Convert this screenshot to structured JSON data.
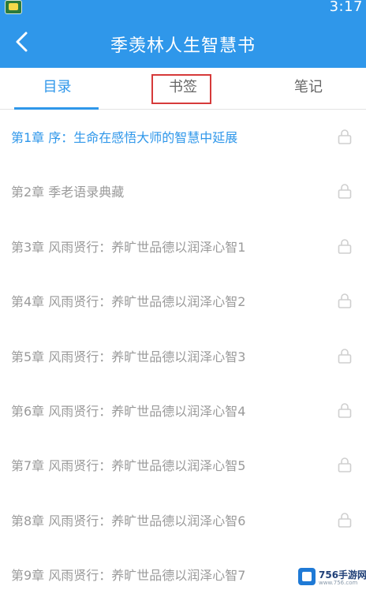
{
  "status_bar": {
    "time": "3:17",
    "app_icon": "app-icon"
  },
  "header": {
    "title": "季羡林人生智慧书",
    "back_icon": "chevron-left-icon"
  },
  "tabs": [
    {
      "label": "目录",
      "selected": true
    },
    {
      "label": "书签",
      "selected": false
    },
    {
      "label": "笔记",
      "selected": false
    }
  ],
  "chapters": [
    {
      "label": "第1章 序：生命在感悟大师的智慧中延展",
      "active": true
    },
    {
      "label": "第2章 季老语录典藏",
      "active": false
    },
    {
      "label": "第3章 风雨贤行：养旷世品德以润泽心智1",
      "active": false
    },
    {
      "label": "第4章 风雨贤行：养旷世品德以润泽心智2",
      "active": false
    },
    {
      "label": "第5章 风雨贤行：养旷世品德以润泽心智3",
      "active": false
    },
    {
      "label": "第6章 风雨贤行：养旷世品德以润泽心智4",
      "active": false
    },
    {
      "label": "第7章 风雨贤行：养旷世品德以润泽心智5",
      "active": false
    },
    {
      "label": "第8章 风雨贤行：养旷世品德以润泽心智6",
      "active": false
    },
    {
      "label": "第9章 风雨贤行：养旷世品德以润泽心智7",
      "active": false
    }
  ],
  "watermark": {
    "brand": "756手游网",
    "site": "www.756.com"
  },
  "colors": {
    "accent": "#2f97ea",
    "chapter_text": "#9a9a9a",
    "highlight_box": "#d63a3a",
    "lock_icon": "#cfcfcf"
  },
  "icons": {
    "lock": "lock-icon"
  }
}
